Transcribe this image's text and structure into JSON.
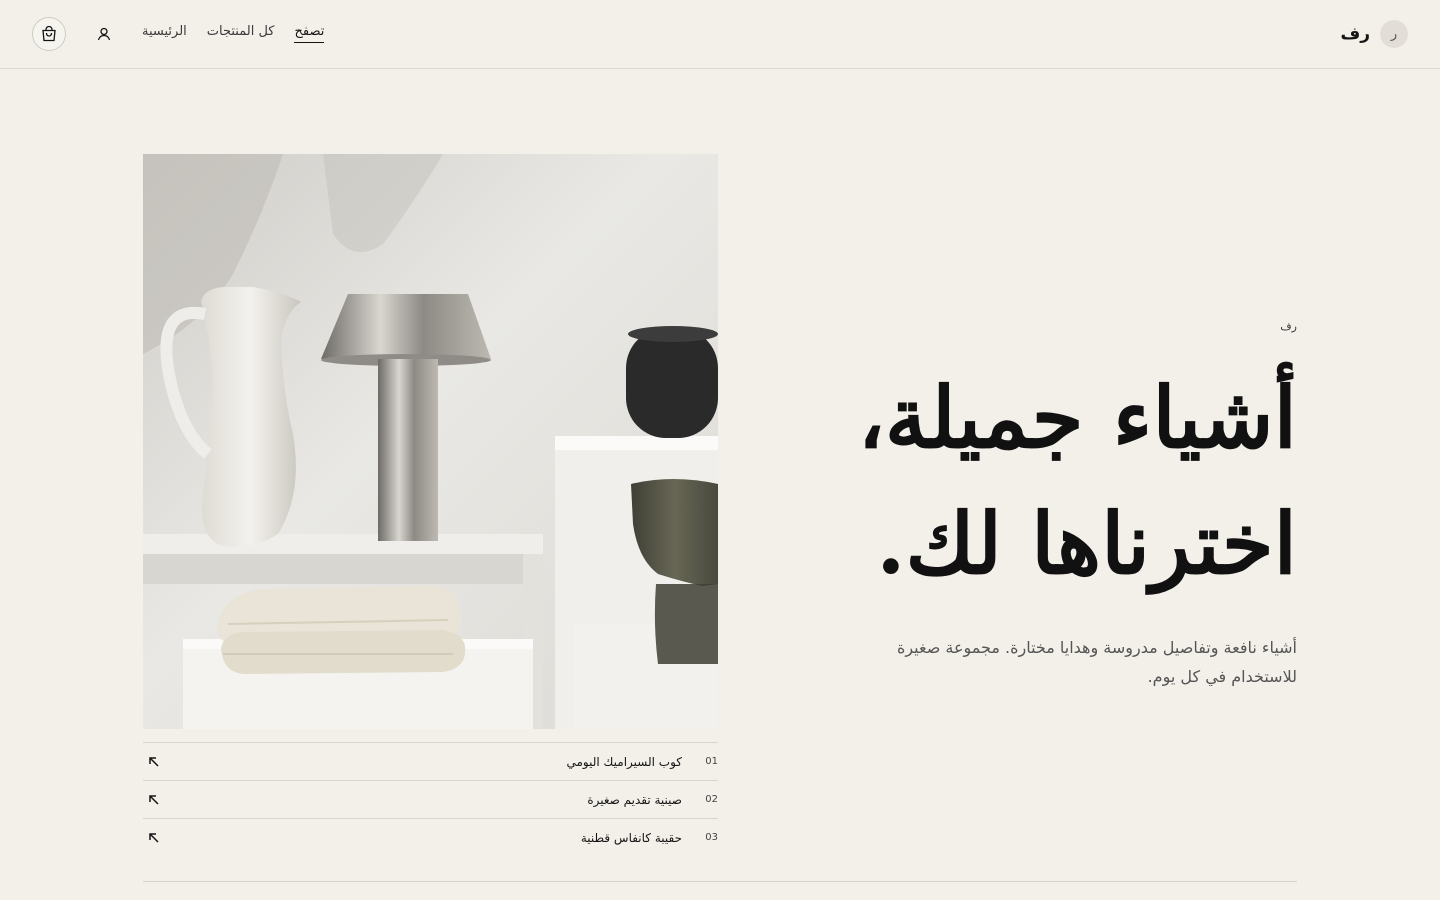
{
  "header": {
    "brand_initial": "ر",
    "brand_name": "رف",
    "nav": [
      {
        "label": "الرئيسية",
        "active": false
      },
      {
        "label": "كل المنتجات",
        "active": false
      },
      {
        "label": "تصفح",
        "active": true
      }
    ],
    "icons": {
      "cart": "shopping-bag-icon",
      "user": "user-icon"
    }
  },
  "hero": {
    "eyebrow": "رف",
    "headline_line1": "أشياء جميلة،",
    "headline_line2": "اخترناها لك.",
    "subtitle": "أشياء نافعة وتفاصيل مدروسة وهدايا مختارة. مجموعة صغيرة للاستخدام في كل يوم."
  },
  "products": [
    {
      "num": "01",
      "name": "كوب السيراميك اليومي",
      "icon": "arrow-up-left-icon"
    },
    {
      "num": "02",
      "name": "صينية تقديم صغيرة",
      "icon": "arrow-up-left-icon"
    },
    {
      "num": "03",
      "name": "حقيبة كانفاس قطنية",
      "icon": "arrow-up-left-icon"
    }
  ],
  "colors": {
    "background": "#f3f0ea",
    "text": "#141414",
    "muted": "#555555",
    "rule": "#d9d5cd"
  }
}
